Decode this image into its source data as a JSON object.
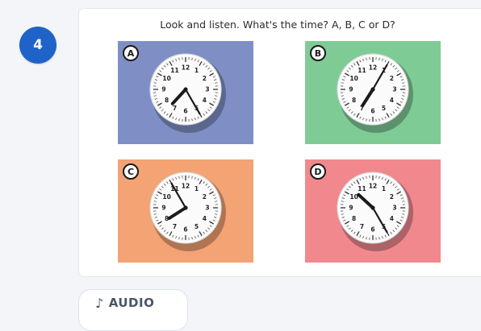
{
  "question": {
    "number": "4",
    "instruction": "Look and listen. What's the time? A, B, C or D?",
    "options": [
      {
        "label": "A",
        "bg": "#7f8fc6",
        "clock": {
          "hour": 7,
          "minute": 25
        }
      },
      {
        "label": "B",
        "bg": "#7ecb96",
        "clock": {
          "hour": 7,
          "minute": 5
        }
      },
      {
        "label": "C",
        "bg": "#f3a374",
        "clock": {
          "hour": 7,
          "minute": 55
        }
      },
      {
        "label": "D",
        "bg": "#f0888e",
        "clock": {
          "hour": 10,
          "minute": 25
        }
      }
    ],
    "clock_numerals": [
      "12",
      "1",
      "2",
      "3",
      "4",
      "5",
      "6",
      "7",
      "8",
      "9",
      "10",
      "11"
    ]
  },
  "audio": {
    "icon": "music-note-icon",
    "label": "AUDIO"
  },
  "colors": {
    "badge": "#1f63c9",
    "hand": "#1a1a1a",
    "audio_text": "#4a5566"
  }
}
